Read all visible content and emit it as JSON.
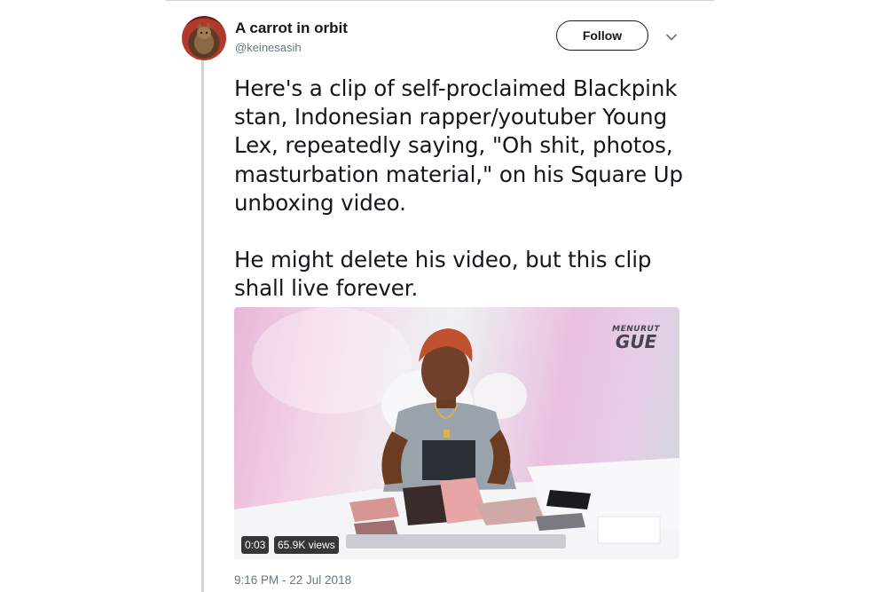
{
  "author": {
    "display_name": "A carrot in orbit",
    "handle": "@keinesasih"
  },
  "follow_button": {
    "label": "Follow"
  },
  "tweet": {
    "text": "Here's a clip of self-proclaimed Blackpink stan, Indonesian rapper/youtuber Young Lex, repeatedly saying, \"Oh shit, photos, masturbation material,\" on his Square Up unboxing video.\n\nHe might delete his video, but this clip shall live forever.",
    "timestamp": "9:16 PM - 22 Jul 2018"
  },
  "video": {
    "duration": "0:03",
    "views": "65.9K views",
    "watermark_top": "MENURUT",
    "watermark_bottom": "GUE"
  },
  "icons": {
    "more": "chevron-down-icon"
  }
}
